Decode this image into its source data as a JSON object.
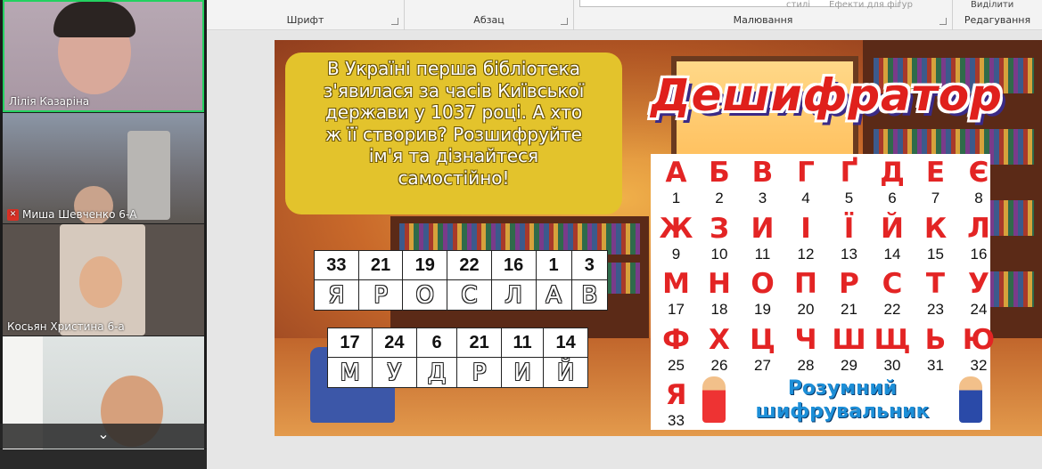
{
  "ribbon": {
    "groups": {
      "font": "Шрифт",
      "paragraph": "Абзац",
      "drawing": "Малювання",
      "editing": "Редагування"
    },
    "faded": {
      "styles": "стилі",
      "shape_effects": "Ефекти для фігур",
      "select": "Виділити"
    }
  },
  "participants": [
    {
      "name": "Лілія Казаріна",
      "muted": false
    },
    {
      "name": "Миша Шевченко 6-А",
      "muted": true
    },
    {
      "name": "Косьян Христина 6-а",
      "muted": false
    },
    {
      "name": "",
      "muted": false
    }
  ],
  "slide": {
    "question_lines": [
      "В Україні перша бібліотека",
      "з'явилася за часів Київської",
      "держави у 1037 році. А хто",
      "ж її створив? Розшифруйте",
      "ім'я та дізнайтеся",
      "самостійно!"
    ],
    "title": "Дешифратор",
    "word1": {
      "numbers": [
        "33",
        "21",
        "19",
        "22",
        "16",
        "1",
        "3"
      ],
      "letters": [
        "Я",
        "Р",
        "О",
        "С",
        "Л",
        "А",
        "В"
      ]
    },
    "word2": {
      "numbers": [
        "17",
        "24",
        "6",
        "21",
        "11",
        "14"
      ],
      "letters": [
        "М",
        "У",
        "Д",
        "Р",
        "И",
        "Й"
      ]
    },
    "cipher": [
      [
        "А",
        "1"
      ],
      [
        "Б",
        "2"
      ],
      [
        "В",
        "3"
      ],
      [
        "Г",
        "4"
      ],
      [
        "Ґ",
        "5"
      ],
      [
        "Д",
        "6"
      ],
      [
        "Е",
        "7"
      ],
      [
        "Є",
        "8"
      ],
      [
        "Ж",
        "9"
      ],
      [
        "З",
        "10"
      ],
      [
        "И",
        "11"
      ],
      [
        "І",
        "12"
      ],
      [
        "Ї",
        "13"
      ],
      [
        "Й",
        "14"
      ],
      [
        "К",
        "15"
      ],
      [
        "Л",
        "16"
      ],
      [
        "М",
        "17"
      ],
      [
        "Н",
        "18"
      ],
      [
        "О",
        "19"
      ],
      [
        "П",
        "20"
      ],
      [
        "Р",
        "21"
      ],
      [
        "С",
        "22"
      ],
      [
        "Т",
        "23"
      ],
      [
        "У",
        "24"
      ],
      [
        "Ф",
        "25"
      ],
      [
        "Х",
        "26"
      ],
      [
        "Ц",
        "27"
      ],
      [
        "Ч",
        "28"
      ],
      [
        "Ш",
        "29"
      ],
      [
        "Щ",
        "30"
      ],
      [
        "Ь",
        "31"
      ],
      [
        "Ю",
        "32"
      ],
      [
        "Я",
        "33"
      ]
    ],
    "brand_lines": [
      "Розумний",
      "шифрувальник"
    ]
  },
  "colors": {
    "cipher_letter": "#e32424",
    "title": "#e0201c",
    "question_box": "#e3c32c",
    "brand": "#1d8fd8",
    "active_speaker": "#23d160"
  }
}
